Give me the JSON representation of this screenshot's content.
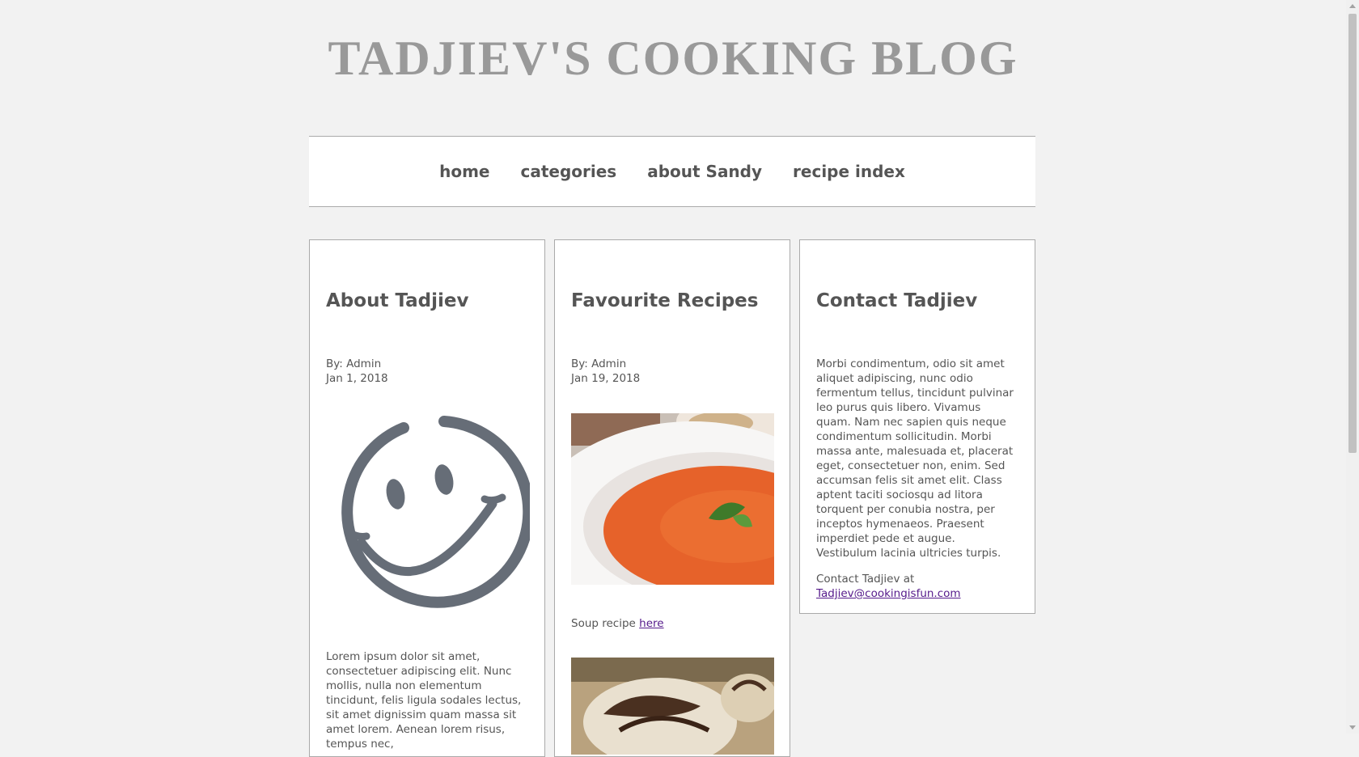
{
  "site": {
    "title": "TADJIEV'S COOKING BLOG"
  },
  "nav": {
    "items": [
      "home",
      "categories",
      "about Sandy",
      "recipe index"
    ]
  },
  "columns": {
    "about": {
      "heading": "About Tadjiev",
      "author": "By: Admin",
      "date": "Jan 1, 2018",
      "image_icon": "smiley-face-icon",
      "text": "Lorem ipsum dolor sit amet, consectetuer adipiscing elit. Nunc mollis, nulla non elementum tincidunt, felis ligula sodales lectus, sit amet dignissim quam massa sit amet lorem. Aenean lorem risus, tempus nec,"
    },
    "recipes": {
      "heading": "Favourite Recipes",
      "author": "By: Admin",
      "date": "Jan 19, 2018",
      "soup_label": "Soup recipe ",
      "soup_link": "here"
    },
    "contact": {
      "heading": "Contact Tadjiev",
      "text": "Morbi condimentum, odio sit amet aliquet adipiscing, nunc odio fermentum tellus, tincidunt pulvinar leo purus quis libero. Vivamus quam. Nam nec sapien quis neque condimentum sollicitudin. Morbi massa ante, malesuada et, placerat eget, consectetuer non, enim. Sed accumsan felis sit amet elit. Class aptent taciti sociosqu ad litora torquent per conubia nostra, per inceptos hymenaeos. Praesent imperdiet pede et augue. Vestibulum lacinia ultricies turpis.",
      "contact_label": "Contact Tadjiev at",
      "email": "Tadjiev@cookingisfun.com"
    }
  },
  "colors": {
    "background": "#f2f2f2",
    "link": "#551a8b",
    "smiley": "#666d77"
  }
}
